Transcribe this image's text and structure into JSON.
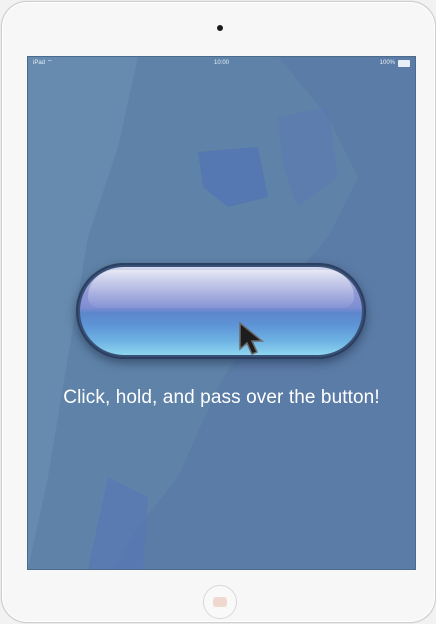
{
  "status_bar": {
    "carrier": "iPad",
    "time": "10:00",
    "battery": "100%"
  },
  "main": {
    "instruction": "Click, hold, and pass over the button!"
  },
  "colors": {
    "screen_background": "#5f83a8",
    "button_top": "#aab1de",
    "button_bottom": "#8fd6f0",
    "text": "#ffffff"
  },
  "icons": {
    "wifi": "wifi-icon",
    "battery": "battery-icon",
    "cursor": "cursor-icon"
  }
}
